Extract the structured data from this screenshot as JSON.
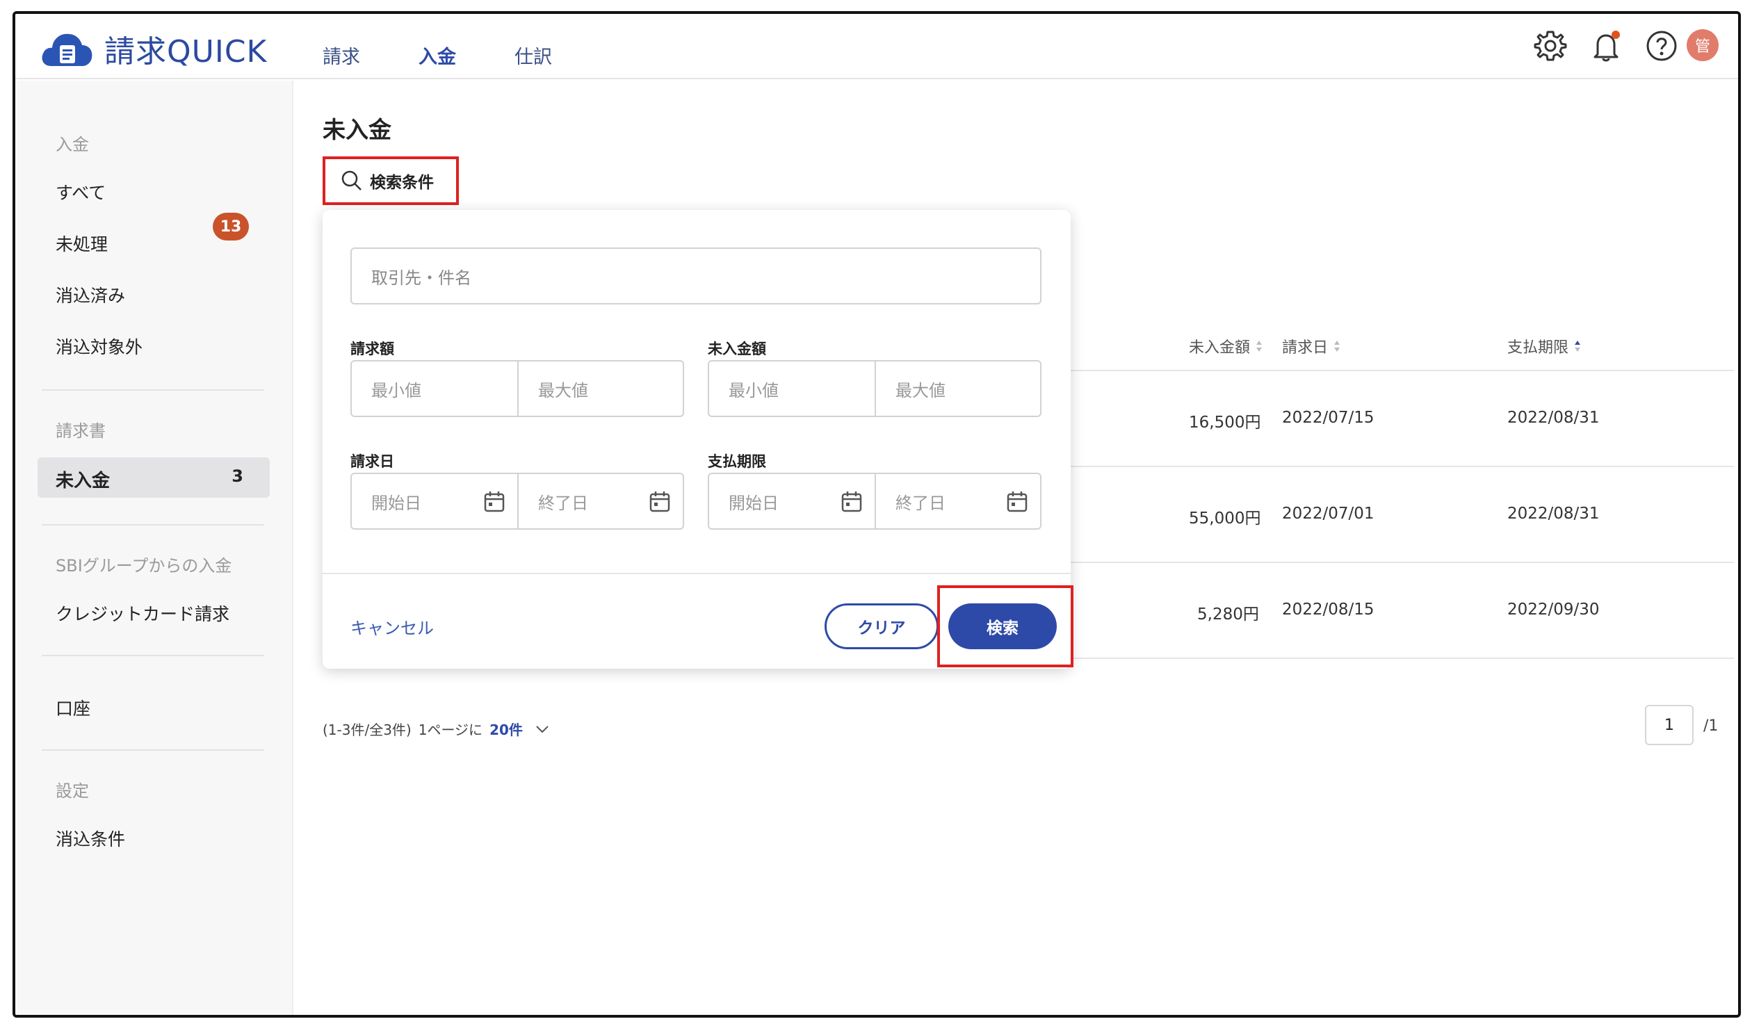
{
  "app": {
    "name": "請求QUICK"
  },
  "nav": {
    "items": [
      "請求",
      "入金",
      "仕訳"
    ],
    "active": "入金"
  },
  "user": {
    "avatar": "管"
  },
  "sidebar": {
    "group_payment": "入金",
    "all": "すべて",
    "unprocessed": "未処理",
    "unprocessed_badge": "13",
    "reconciled": "消込済み",
    "excluded": "消込対象外",
    "group_invoice": "請求書",
    "unpaid": "未入金",
    "unpaid_count": "3",
    "sbi": "SBIグループからの入金",
    "credit": "クレジットカード請求",
    "account": "口座",
    "group_settings": "設定",
    "reconcile_rules": "消込条件"
  },
  "main": {
    "title": "未入金",
    "search_toggle": "検索条件"
  },
  "search_panel": {
    "keyword_placeholder": "取引先・件名",
    "amount_label": "請求額",
    "unpaid_amount_label": "未入金額",
    "min_placeholder": "最小値",
    "max_placeholder": "最大値",
    "invoice_date_label": "請求日",
    "due_date_label": "支払期限",
    "start_placeholder": "開始日",
    "end_placeholder": "終了日",
    "cancel": "キャンセル",
    "clear": "クリア",
    "search": "検索"
  },
  "table": {
    "headers": {
      "unpaid_amount": "未入金額",
      "invoice_date": "請求日",
      "due_date": "支払期限"
    },
    "rows": [
      {
        "amount": "16,500円",
        "invoice_date": "2022/07/15",
        "due_date": "2022/08/31"
      },
      {
        "amount": "55,000円",
        "invoice_date": "2022/07/01",
        "due_date": "2022/08/31"
      },
      {
        "amount": "5,280円",
        "invoice_date": "2022/08/15",
        "due_date": "2022/09/30"
      }
    ]
  },
  "pagination": {
    "summary": "(1-3件/全3件)",
    "per_page_label": "1ページに",
    "per_page_value": "20件",
    "current_page": "1",
    "total_pages": "/1"
  },
  "colors": {
    "accent": "#2e4aa8",
    "badge": "#c9532a",
    "highlight": "#e02020"
  }
}
